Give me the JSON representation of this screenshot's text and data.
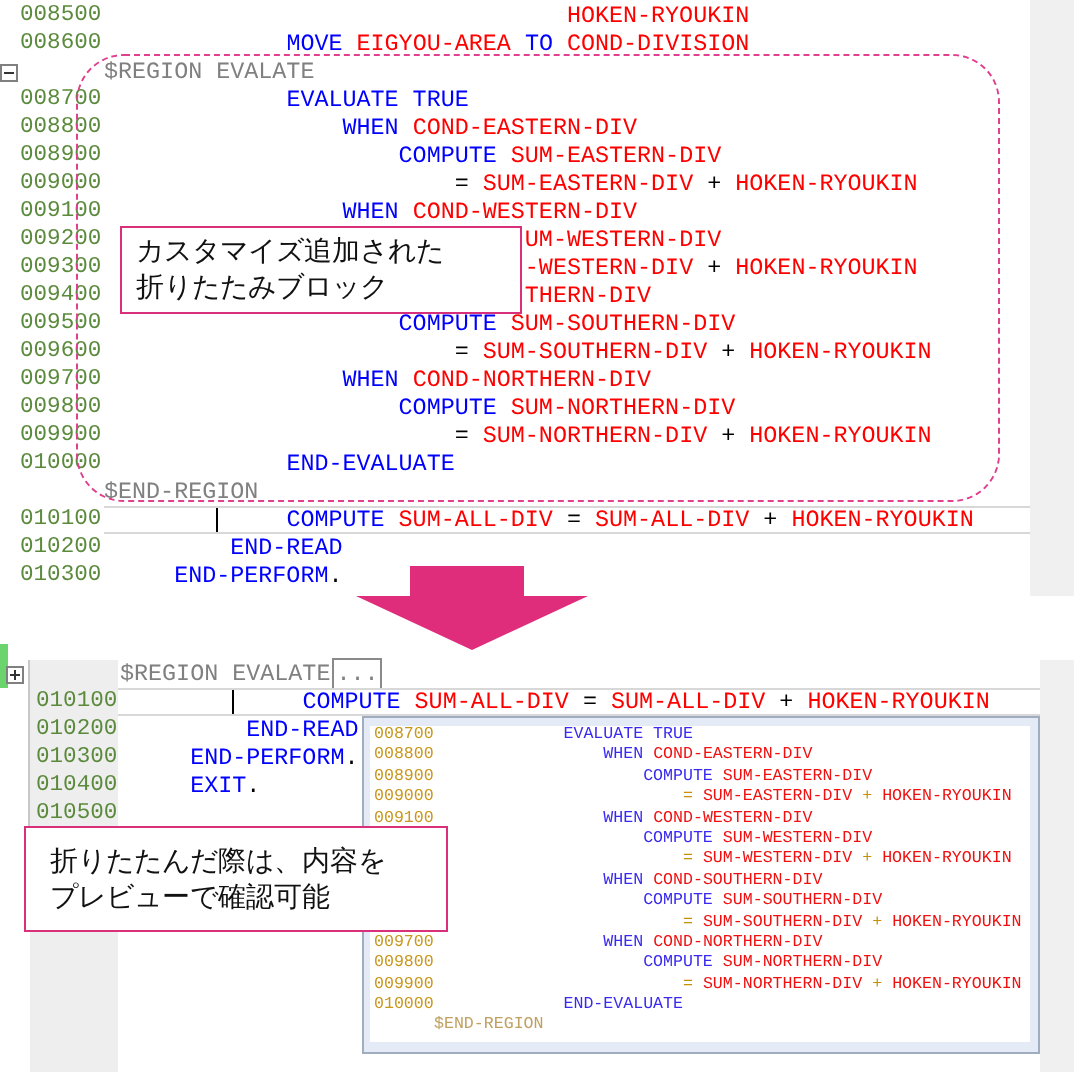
{
  "editor": {
    "lines": [
      {
        "kind": "code",
        "num": "008500",
        "current": false,
        "tokens": [
          {
            "kind": "id",
            "text": "                                 HOKEN-RYOUKIN"
          }
        ]
      },
      {
        "kind": "code",
        "num": "008600",
        "current": false,
        "tokens": [
          {
            "kind": "kw",
            "text": "             MOVE "
          },
          {
            "kind": "id",
            "text": "EIGYOU-AREA "
          },
          {
            "kind": "kw",
            "text": "TO "
          },
          {
            "kind": "id",
            "text": "COND-DIVISION"
          }
        ]
      },
      {
        "kind": "region-start",
        "expanded": true,
        "tokens": [
          {
            "kind": "dir",
            "text": "$REGION EVALATE"
          }
        ]
      },
      {
        "kind": "code",
        "num": "008700",
        "current": false,
        "tokens": [
          {
            "kind": "kw",
            "text": "             EVALUATE TRUE"
          }
        ]
      },
      {
        "kind": "code",
        "num": "008800",
        "current": false,
        "tokens": [
          {
            "kind": "kw",
            "text": "                 WHEN "
          },
          {
            "kind": "id",
            "text": "COND-EASTERN-DIV"
          }
        ]
      },
      {
        "kind": "code",
        "num": "008900",
        "current": false,
        "tokens": [
          {
            "kind": "kw",
            "text": "                     COMPUTE "
          },
          {
            "kind": "id",
            "text": "SUM-EASTERN-DIV"
          }
        ]
      },
      {
        "kind": "code",
        "num": "009000",
        "current": false,
        "tokens": [
          {
            "kind": "op",
            "text": "                         = "
          },
          {
            "kind": "id",
            "text": "SUM-EASTERN-DIV"
          },
          {
            "kind": "op",
            "text": " + "
          },
          {
            "kind": "id",
            "text": "HOKEN-RYOUKIN"
          }
        ]
      },
      {
        "kind": "code",
        "num": "009100",
        "current": false,
        "tokens": [
          {
            "kind": "kw",
            "text": "                 WHEN "
          },
          {
            "kind": "id",
            "text": "COND-WESTERN-DIV"
          }
        ]
      },
      {
        "kind": "code",
        "num": "009200",
        "current": false,
        "tokens": [
          {
            "kind": "id",
            "text": "                              UM-WESTERN-DIV"
          }
        ]
      },
      {
        "kind": "code",
        "num": "009300",
        "current": false,
        "tokens": [
          {
            "kind": "id",
            "text": "                              -WESTERN-DIV"
          },
          {
            "kind": "op",
            "text": " + "
          },
          {
            "kind": "id",
            "text": "HOKEN-RYOUKIN"
          }
        ]
      },
      {
        "kind": "code",
        "num": "009400",
        "current": false,
        "tokens": [
          {
            "kind": "id",
            "text": "                              THERN-DIV"
          }
        ]
      },
      {
        "kind": "code",
        "num": "009500",
        "current": false,
        "tokens": [
          {
            "kind": "kw",
            "text": "                     COMPUTE "
          },
          {
            "kind": "id",
            "text": "SUM-SOUTHERN-DIV"
          }
        ]
      },
      {
        "kind": "code",
        "num": "009600",
        "current": false,
        "tokens": [
          {
            "kind": "op",
            "text": "                         = "
          },
          {
            "kind": "id",
            "text": "SUM-SOUTHERN-DIV"
          },
          {
            "kind": "op",
            "text": " + "
          },
          {
            "kind": "id",
            "text": "HOKEN-RYOUKIN"
          }
        ]
      },
      {
        "kind": "code",
        "num": "009700",
        "current": false,
        "tokens": [
          {
            "kind": "kw",
            "text": "                 WHEN "
          },
          {
            "kind": "id",
            "text": "COND-NORTHERN-DIV"
          }
        ]
      },
      {
        "kind": "code",
        "num": "009800",
        "current": false,
        "tokens": [
          {
            "kind": "kw",
            "text": "                     COMPUTE "
          },
          {
            "kind": "id",
            "text": "SUM-NORTHERN-DIV"
          }
        ]
      },
      {
        "kind": "code",
        "num": "009900",
        "current": false,
        "tokens": [
          {
            "kind": "op",
            "text": "                         = "
          },
          {
            "kind": "id",
            "text": "SUM-NORTHERN-DIV"
          },
          {
            "kind": "op",
            "text": " + "
          },
          {
            "kind": "id",
            "text": "HOKEN-RYOUKIN"
          }
        ]
      },
      {
        "kind": "code",
        "num": "010000",
        "current": false,
        "tokens": [
          {
            "kind": "kw",
            "text": "             END-EVALUATE"
          }
        ]
      },
      {
        "kind": "region-end",
        "tokens": [
          {
            "kind": "dir",
            "text": "$END-REGION"
          }
        ]
      },
      {
        "kind": "code",
        "num": "010100",
        "current": true,
        "tokens": [
          {
            "kind": "kw",
            "text": "             COMPUTE "
          },
          {
            "kind": "id",
            "text": "SUM-ALL-DIV"
          },
          {
            "kind": "op",
            "text": " = "
          },
          {
            "kind": "id",
            "text": "SUM-ALL-DIV"
          },
          {
            "kind": "op",
            "text": " + "
          },
          {
            "kind": "id",
            "text": "HOKEN-RYOUKIN"
          }
        ]
      },
      {
        "kind": "code",
        "num": "010200",
        "current": false,
        "tokens": [
          {
            "kind": "kw",
            "text": "         END-READ"
          }
        ]
      },
      {
        "kind": "code",
        "num": "010300",
        "current": false,
        "tokens": [
          {
            "kind": "kw",
            "text": "     END-PERFORM"
          },
          {
            "kind": "op",
            "text": "."
          }
        ]
      }
    ]
  },
  "callout_top": {
    "text": "カスタマイズ追加された折りたたみブロック"
  },
  "folded_editor": {
    "lines": [
      {
        "kind": "region-start",
        "expanded": false,
        "tokens": [
          {
            "kind": "dir",
            "text": "$REGION EVALATE"
          }
        ],
        "folded_text": "..."
      },
      {
        "kind": "code",
        "num": "010100",
        "current": true,
        "tokens": [
          {
            "kind": "kw",
            "text": "             COMPUTE "
          },
          {
            "kind": "id",
            "text": "SUM-ALL-DIV"
          },
          {
            "kind": "op",
            "text": " = "
          },
          {
            "kind": "id",
            "text": "SUM-ALL-DIV"
          },
          {
            "kind": "op",
            "text": " + "
          },
          {
            "kind": "id",
            "text": "HOKEN-RYOUKIN"
          }
        ]
      },
      {
        "kind": "code",
        "num": "010200",
        "current": false,
        "tokens": [
          {
            "kind": "kw",
            "text": "         END-READ"
          }
        ]
      },
      {
        "kind": "code",
        "num": "010300",
        "current": false,
        "tokens": [
          {
            "kind": "kw",
            "text": "     END-PERFORM"
          },
          {
            "kind": "op",
            "text": "."
          }
        ]
      },
      {
        "kind": "code",
        "num": "010400",
        "current": false,
        "tokens": [
          {
            "kind": "kw",
            "text": "     EXIT"
          },
          {
            "kind": "op",
            "text": "."
          }
        ]
      },
      {
        "kind": "code",
        "num": "010500",
        "current": false
      }
    ]
  },
  "preview": {
    "lines": [
      {
        "num": "008700",
        "tokens": [
          {
            "kind": "kw",
            "text": "             EVALUATE TRUE"
          }
        ]
      },
      {
        "num": "008800",
        "tokens": [
          {
            "kind": "kw",
            "text": "                 WHEN "
          },
          {
            "kind": "id",
            "text": "COND-EASTERN-DIV"
          }
        ]
      },
      {
        "num": "008900",
        "tokens": [
          {
            "kind": "kw",
            "text": "                     COMPUTE "
          },
          {
            "kind": "id",
            "text": "SUM-EASTERN-DIV"
          }
        ]
      },
      {
        "num": "009000",
        "tokens": [
          {
            "kind": "op",
            "text": "                         = "
          },
          {
            "kind": "id",
            "text": "SUM-EASTERN-DIV"
          },
          {
            "kind": "op",
            "text": " + "
          },
          {
            "kind": "id",
            "text": "HOKEN-RYOUKIN"
          }
        ]
      },
      {
        "num": "009100",
        "tokens": [
          {
            "kind": "kw",
            "text": "                 WHEN "
          },
          {
            "kind": "id",
            "text": "COND-WESTERN-DIV"
          }
        ]
      },
      {
        "tokens": [
          {
            "kind": "kw",
            "text": "                     COMPUTE "
          },
          {
            "kind": "id",
            "text": "SUM-WESTERN-DIV"
          }
        ]
      },
      {
        "tokens": [
          {
            "kind": "op",
            "text": "                         = "
          },
          {
            "kind": "id",
            "text": "SUM-WESTERN-DIV"
          },
          {
            "kind": "op",
            "text": " + "
          },
          {
            "kind": "id",
            "text": "HOKEN-RYOUKIN"
          }
        ]
      },
      {
        "tokens": [
          {
            "kind": "kw",
            "text": "                 WHEN "
          },
          {
            "kind": "id",
            "text": "COND-SOUTHERN-DIV"
          }
        ]
      },
      {
        "tokens": [
          {
            "kind": "kw",
            "text": "                     COMPUTE "
          },
          {
            "kind": "id",
            "text": "SUM-SOUTHERN-DIV"
          }
        ]
      },
      {
        "tokens": [
          {
            "kind": "op",
            "text": "                         = "
          },
          {
            "kind": "id",
            "text": "SUM-SOUTHERN-DIV"
          },
          {
            "kind": "op",
            "text": " + "
          },
          {
            "kind": "id",
            "text": "HOKEN-RYOUKIN"
          }
        ]
      },
      {
        "num": "009700",
        "tokens": [
          {
            "kind": "kw",
            "text": "                 WHEN "
          },
          {
            "kind": "id",
            "text": "COND-NORTHERN-DIV"
          }
        ]
      },
      {
        "num": "009800",
        "tokens": [
          {
            "kind": "kw",
            "text": "                     COMPUTE "
          },
          {
            "kind": "id",
            "text": "SUM-NORTHERN-DIV"
          }
        ]
      },
      {
        "num": "009900",
        "tokens": [
          {
            "kind": "op",
            "text": "                         = "
          },
          {
            "kind": "id",
            "text": "SUM-NORTHERN-DIV"
          },
          {
            "kind": "op",
            "text": " + "
          },
          {
            "kind": "id",
            "text": "HOKEN-RYOUKIN"
          }
        ]
      },
      {
        "num": "010000",
        "tokens": [
          {
            "kind": "kw",
            "text": "             END-EVALUATE"
          }
        ]
      },
      {
        "tokens": [
          {
            "kind": "dir",
            "text": "$END-REGION"
          }
        ]
      }
    ]
  },
  "callout_bottom": {
    "text": "折りたたんだ際は、内容をプレビューで確認可能"
  }
}
